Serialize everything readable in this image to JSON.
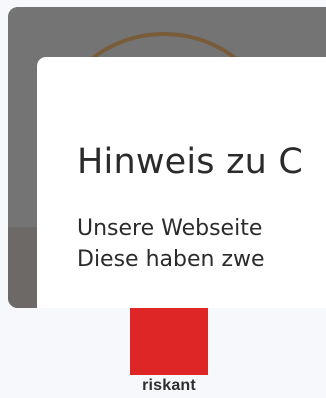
{
  "consent_dialog": {
    "title": "Hinweis zu C",
    "text_lines": [
      "Unsere Webseite",
      "Diese haben zwe"
    ]
  },
  "risk_indicator": {
    "label": "riskant",
    "color": "#de2626"
  }
}
